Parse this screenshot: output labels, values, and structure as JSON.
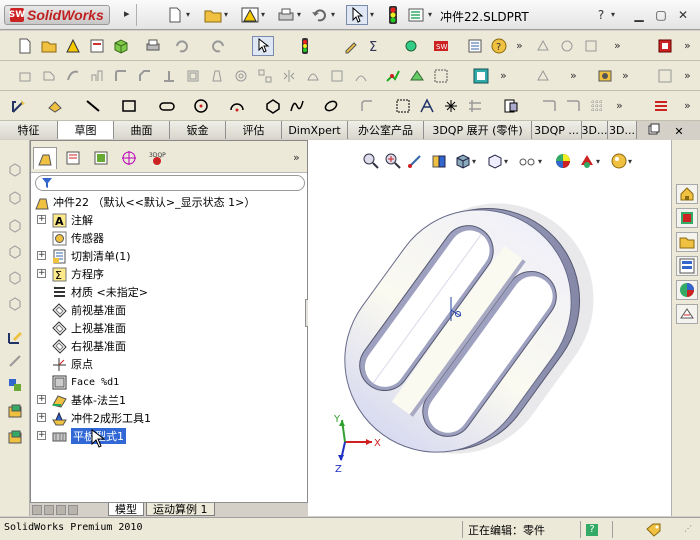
{
  "app": {
    "logo_text": "SolidWorks",
    "logo_mark": "SW",
    "document_title": "冲件22.SLDPRT",
    "help": "?",
    "status_text": "SolidWorks Premium 2010",
    "status_editing": "正在编辑：零件",
    "status_help": "?"
  },
  "command_tabs": [
    "特征",
    "草图",
    "曲面",
    "钣金",
    "评估",
    "DimXpert",
    "办公室产品",
    "3DQP 展开 (零件)",
    "3DQP ...",
    "3D...",
    "3D..."
  ],
  "active_tab_index": 1,
  "tree": {
    "root": "冲件22 （默认<<默认>_显示状态 1>）",
    "items": [
      {
        "label": "注解",
        "icon": "annotation-icon",
        "expandable": true
      },
      {
        "label": "传感器",
        "icon": "sensor-icon",
        "expandable": false
      },
      {
        "label": "切割清单(1)",
        "icon": "cutlist-icon",
        "expandable": true
      },
      {
        "label": "方程序",
        "icon": "equation-icon",
        "expandable": true
      },
      {
        "label": "材质 <未指定>",
        "icon": "material-icon",
        "expandable": false
      },
      {
        "label": "前视基准面",
        "icon": "plane-icon",
        "expandable": false
      },
      {
        "label": "上视基准面",
        "icon": "plane-icon",
        "expandable": false
      },
      {
        "label": "右视基准面",
        "icon": "plane-icon",
        "expandable": false
      },
      {
        "label": "原点",
        "icon": "origin-icon",
        "expandable": false
      },
      {
        "label": "Face %d1",
        "icon": "face-icon",
        "expandable": false
      },
      {
        "label": "基体-法兰1",
        "icon": "base-flange-icon",
        "expandable": true
      },
      {
        "label": "冲件2成形工具1",
        "icon": "forming-tool-icon",
        "expandable": true
      },
      {
        "label": "平板型式1",
        "icon": "flat-pattern-icon",
        "expandable": true
      }
    ],
    "selected_index": 12
  },
  "bottom_tabs": [
    "模型",
    "运动算例 1"
  ],
  "triad": {
    "x": "X",
    "y": "Y",
    "z": "Z"
  },
  "colors": {
    "tab_bg": "#ece9d8",
    "selection": "#3168d5",
    "logo_red": "#c02020",
    "model_face": "#fbfaf0",
    "model_side": "#a8aac4"
  }
}
